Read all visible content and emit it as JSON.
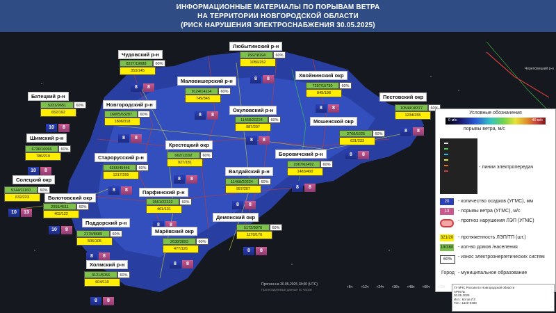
{
  "header": {
    "line1": "ИНФОРМАЦИОННЫЕ МАТЕРИАЛЫ ПО ПОРЫВАМ ВЕТРА",
    "line2": "НА ТЕРРИТОРИИ НОВГОРОДСКОЙ ОБЛАСТИ",
    "line3": "(РИСК НАРУШЕНИЯ ЭЛЕКТРОСНАБЖЕНИЯ 30.05.2025)"
  },
  "districts": [
    {
      "id": "chudovsky",
      "name": "Чудовский р-н",
      "green": "8227/19688",
      "pct": "60%",
      "yellow": "353/145",
      "rain": "8",
      "wind": "8"
    },
    {
      "id": "lyubytinsky",
      "name": "Любытинский р-н",
      "green": "7667/8194",
      "pct": "60%",
      "yellow": "1056/252",
      "rain": "8",
      "wind": "8"
    },
    {
      "id": "malovishersky",
      "name": "Маловишерский р-н",
      "green": "9124/14114",
      "pct": "60%",
      "yellow": "749/345",
      "rain": "8",
      "wind": "8"
    },
    {
      "id": "khvoyninsky",
      "name": "Хвойнинский окр",
      "green": "7297/15730",
      "pct": "60%",
      "yellow": "849/198",
      "rain": "8",
      "wind": "8"
    },
    {
      "id": "batetsky",
      "name": "Батецкий р-н",
      "green": "5331/9651",
      "pct": "60%",
      "yellow": "652/192",
      "rain": "10",
      "wind": "8"
    },
    {
      "id": "novgorodsky",
      "name": "Новгородский р-н",
      "green": "16005/63287",
      "pct": "60%",
      "yellow": "1806/318",
      "rain": "8",
      "wind": "8"
    },
    {
      "id": "okulovsky",
      "name": "Окуловский р-н",
      "green": "11468/20224",
      "pct": "60%",
      "yellow": "987/207",
      "rain": "8",
      "wind": "8"
    },
    {
      "id": "pestovsky",
      "name": "Пестовский окр",
      "green": "10544/18377",
      "pct": "60%",
      "yellow": "1234/255",
      "rain": "8",
      "wind": "8"
    },
    {
      "id": "moshenskoy",
      "name": "Мошенской окр",
      "green": "2769/5225",
      "pct": "60%",
      "yellow": "631/233",
      "rain": "8",
      "wind": "8"
    },
    {
      "id": "shimsky",
      "name": "Шимский р-н",
      "green": "6736/10066",
      "pct": "60%",
      "yellow": "786/219",
      "rain": "10",
      "wind": "8"
    },
    {
      "id": "krestetsky",
      "name": "Крестецкий окр",
      "green": "662/11192",
      "pct": "60%",
      "yellow": "927/181",
      "rain": "8",
      "wind": "8"
    },
    {
      "id": "borovichsky",
      "name": "Боровичский р-н",
      "green": "2067/62492",
      "pct": "60%",
      "yellow": "1483/400",
      "rain": "8",
      "wind": "8"
    },
    {
      "id": "starorussky",
      "name": "Старорусский р-н",
      "green": "6366/45446",
      "pct": "60%",
      "yellow": "1217/259",
      "rain": "8",
      "wind": "8"
    },
    {
      "id": "soletsky",
      "name": "Солецкий окр",
      "green": "9144/11160",
      "pct": "60%",
      "yellow": "632/223",
      "rain": "10",
      "wind": "13"
    },
    {
      "id": "valdaysky",
      "name": "Валдайский р-н",
      "green": "11468/20224",
      "pct": "60%",
      "yellow": "957/207",
      "rain": "8",
      "wind": "8"
    },
    {
      "id": "volotovsky",
      "name": "Волотовский окр",
      "green": "2055/4511",
      "pct": "60%",
      "yellow": "402/122",
      "rain": "10",
      "wind": "8"
    },
    {
      "id": "parfinsky",
      "name": "Парфинский р-н",
      "green": "3561/22222",
      "pct": "60%",
      "yellow": "461/131",
      "rain": "8",
      "wind": "8"
    },
    {
      "id": "poddorsky",
      "name": "Поддорский р-н",
      "green": "2178/8689",
      "pct": "60%",
      "yellow": "506/105",
      "rain": "8",
      "wind": "8"
    },
    {
      "id": "maryovsky",
      "name": "Марёвский окр",
      "green": "2638/3893",
      "pct": "60%",
      "yellow": "477/126",
      "rain": "8",
      "wind": "8"
    },
    {
      "id": "demyansky",
      "name": "Демянский окр",
      "green": "5172/9970",
      "pct": "60%",
      "yellow": "1170/176",
      "rain": "8",
      "wind": "8"
    },
    {
      "id": "kholmsky",
      "name": "Холмский р-н",
      "green": "3121/5056",
      "pct": "60%",
      "yellow": "604/110",
      "rain": "8",
      "wind": "8"
    }
  ],
  "legend": {
    "title": "Условные обозначения",
    "scale_min": "0 м/с",
    "scale_max": "40 м/с",
    "gust_label": "порывы ветра, м/с",
    "power_lines": "- линии электропередач",
    "rain_value": "20",
    "rain_text": "- количество осадков (УГМС), мм",
    "wind_value": "13",
    "wind_text": "- порывы ветра (УГМС), м/с",
    "risk_text": "- прогноз нарушения ЛЭП (УГМС)",
    "yellow_value": "321/20",
    "yellow_text": "- протяженность ЛЭП/ТП (шт.)",
    "green_value": "19/380",
    "green_text": "- кол-во домов /населения",
    "wear_value": "60%",
    "wear_text": "- износ электроэнергетических систем",
    "city_word": "Город",
    "city_text": "- муниципальное образование",
    "power_levels": [
      "#e6e6e6",
      "#3fd23f",
      "#2fb4e6",
      "#e6e63a",
      "#e06b2b",
      "#d23a3a"
    ],
    "accent": "#2f4d84"
  },
  "timeline": {
    "title": "Прогноз на 30.05.2025 18:00 (UTC)",
    "subtitle": "Прогнозируемые данные по часам",
    "steps": [
      "+6ч",
      "+12ч",
      "+24ч",
      "+36ч",
      "+48ч",
      "+60ч",
      "+72ч"
    ]
  },
  "info": {
    "line1": "ГУ МЧС России по Новгородской области",
    "line2": "АРМ №",
    "line3": "30.05.2025",
    "line4": "Исп.: Котов Л.Г.",
    "line5": "Тел.: 1340-0400"
  },
  "map_label_ne": "Череповецкий р-н"
}
